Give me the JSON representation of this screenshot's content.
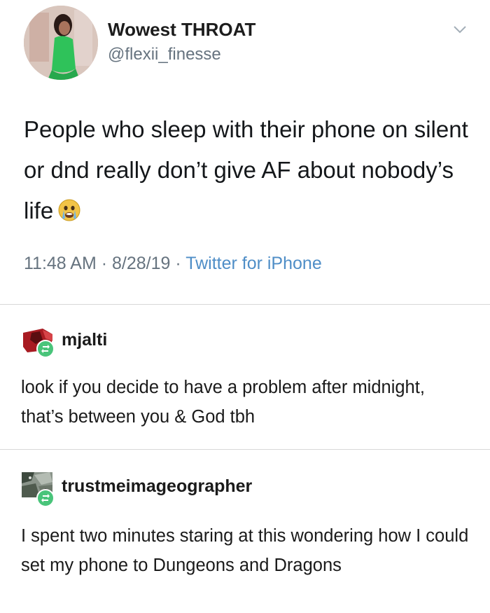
{
  "tweet": {
    "display_name": "Wowest THROAT",
    "handle": "@flexii_finesse",
    "text": "People who sleep with their phone on silent or dnd really don’t give AF about nobody’s life",
    "emoji": "crying-face-emoji",
    "time": "11:48 AM",
    "date": "8/28/19",
    "source": "Twitter for iPhone",
    "separator": " · "
  },
  "reblogs": [
    {
      "username": "mjalti",
      "text": "look if you decide to have a problem after midnight, that’s between you & God tbh",
      "avatar_color": "#b01c22"
    },
    {
      "username": "trustmeimageographer",
      "text": "I spent two minutes staring at this wondering how I could set my phone to Dungeons and Dragons",
      "avatar_color": "#5c6a5a"
    }
  ],
  "colors": {
    "link": "#4f8ec7",
    "muted": "#66737f",
    "reblog_badge": "#49c47a"
  }
}
